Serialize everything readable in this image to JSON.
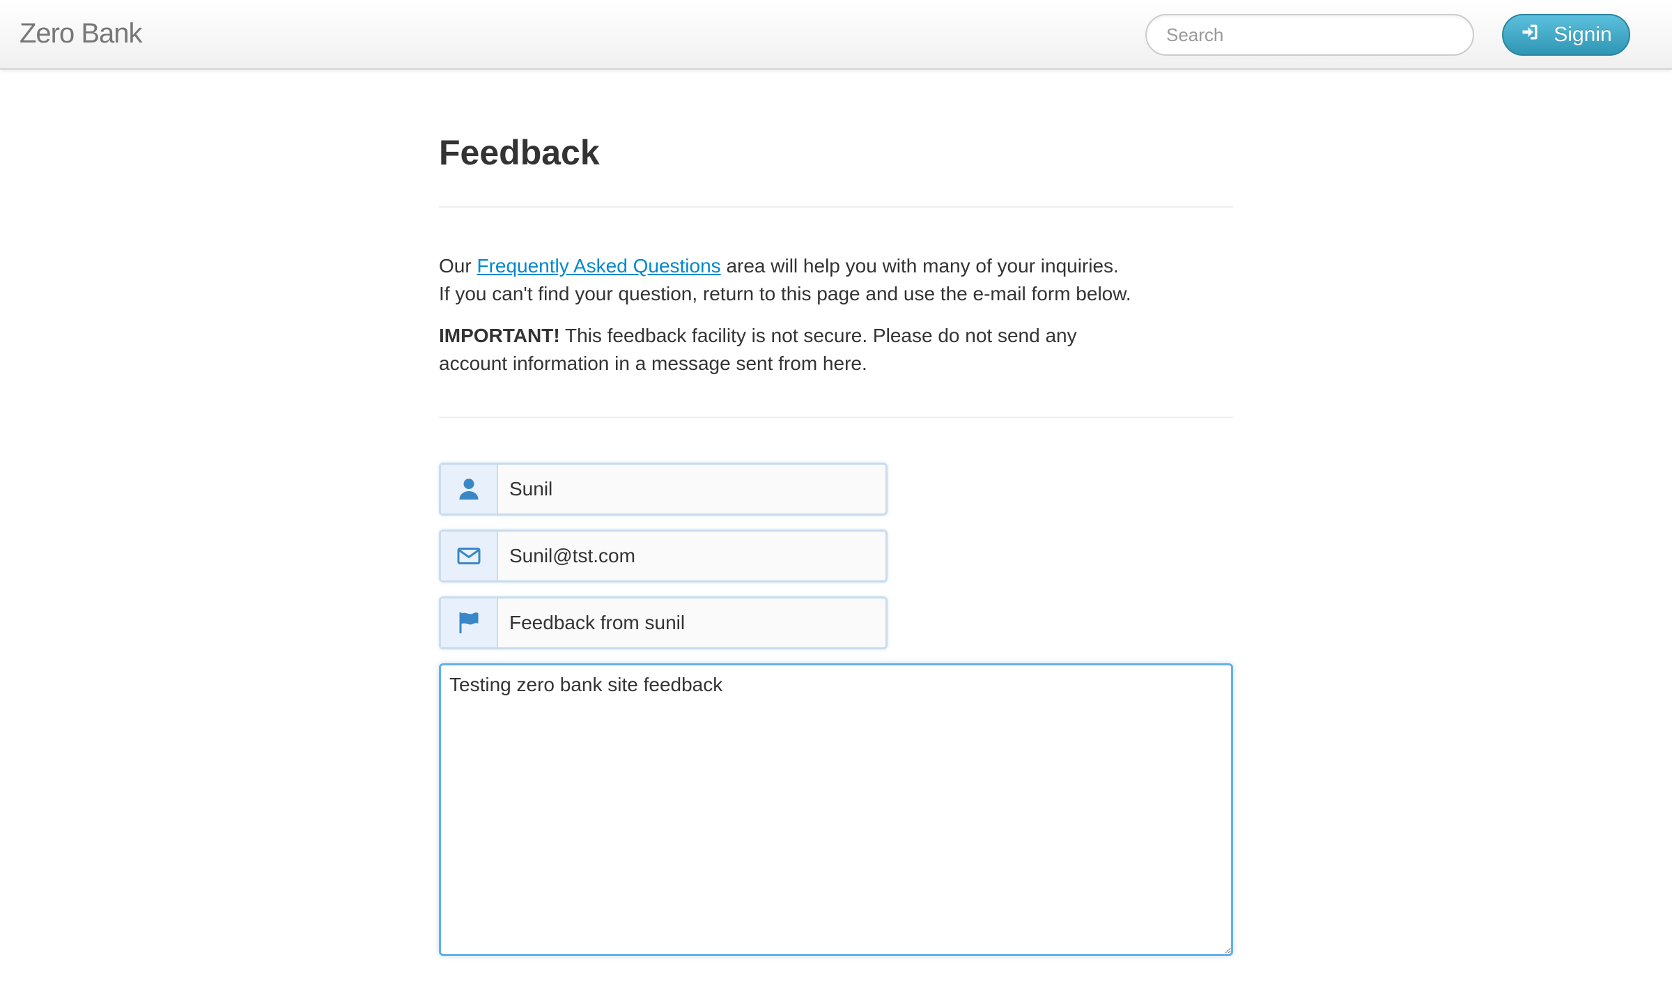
{
  "navbar": {
    "brand": "Zero Bank",
    "search": {
      "placeholder": "Search",
      "value": ""
    },
    "signin_label": "Signin"
  },
  "page": {
    "title": "Feedback",
    "intro": {
      "prefix": "Our ",
      "faq_link": "Frequently Asked Questions",
      "suffix": " area will help you with many of your inquiries.",
      "line2": "If you can't find your question, return to this page and use the e-mail form below."
    },
    "warning": {
      "label": "IMPORTANT!",
      "text": " This feedback facility is not secure. Please do not send any account information in a message sent from here."
    }
  },
  "form": {
    "name": {
      "value": "Sunil",
      "icon": "user-icon"
    },
    "email": {
      "value": "Sunil@tst.com",
      "icon": "envelope-icon"
    },
    "subject": {
      "value": "Feedback from sunil",
      "icon": "flag-icon"
    },
    "comment": {
      "value": "Testing zero bank site feedback"
    }
  },
  "colors": {
    "accent": "#5bc0de",
    "link": "#0088cc",
    "icon": "#3a87c8"
  }
}
